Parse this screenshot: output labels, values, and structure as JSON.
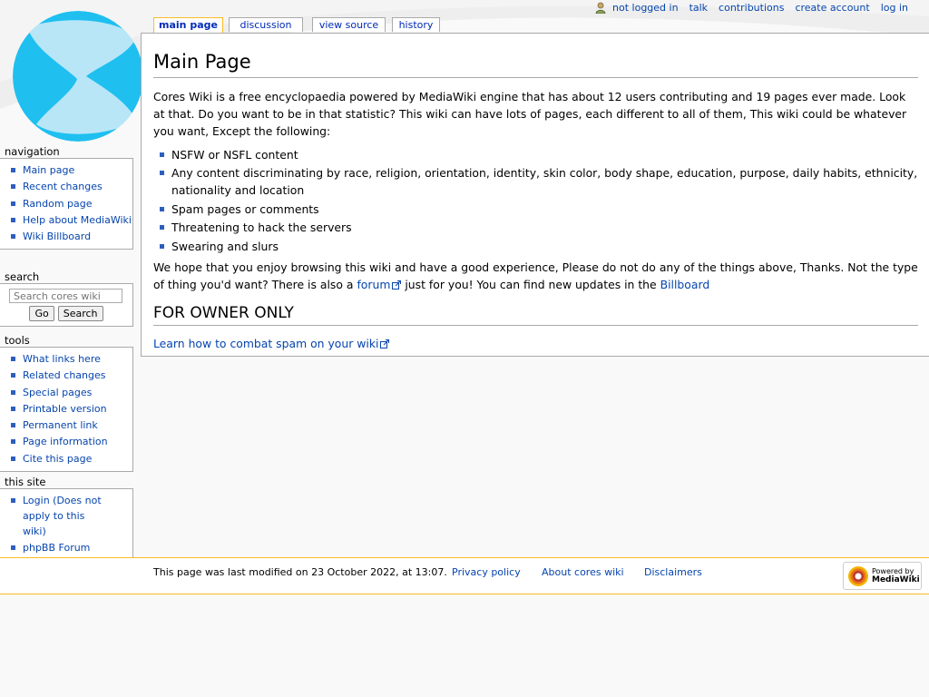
{
  "personal_tools": [
    {
      "label": "not logged in"
    },
    {
      "label": "talk"
    },
    {
      "label": "contributions"
    },
    {
      "label": "create account"
    },
    {
      "label": "log in"
    }
  ],
  "tabs": [
    {
      "label": "main page",
      "selected": true
    },
    {
      "label": "discussion"
    },
    {
      "label": "view source"
    },
    {
      "label": "history"
    }
  ],
  "page": {
    "title": "Main Page",
    "intro": "Cores Wiki is a free encyclopaedia powered by MediaWiki engine that has about 12 users contributing and 19 pages ever made. Look at that. Do you want to be in that statistic? This wiki can have lots of pages, each different to all of them, This wiki could be whatever you want, Except the following:",
    "rules": [
      "NSFW or NSFL content",
      "Any content discriminating by race, religion, orientation, identity, skin color, body shape, education, purpose, daily habits, ethnicity, nationality and location",
      "Spam pages or comments",
      "Threatening to hack the servers",
      "Swearing and slurs"
    ],
    "outro_before_forum": "We hope that you enjoy browsing this wiki and have a good experience, Please do not do any of the things above, Thanks. Not the type of thing you'd want? There is also a ",
    "forum_link": "forum",
    "outro_middle": " just for you! You can find new updates in the ",
    "billboard_link": "Billboard",
    "owner_heading": "FOR OWNER ONLY",
    "spam_link": "Learn how to combat spam on your wiki"
  },
  "navigation": {
    "title": "navigation",
    "items": [
      {
        "label": "Main page"
      },
      {
        "label": "Recent changes"
      },
      {
        "label": "Random page"
      },
      {
        "label": "Help about MediaWiki"
      },
      {
        "label": "Wiki Billboard"
      }
    ]
  },
  "search": {
    "title": "search",
    "placeholder": "Search cores wiki",
    "go_label": "Go",
    "search_label": "Search"
  },
  "tools": {
    "title": "tools",
    "items": [
      {
        "label": "What links here"
      },
      {
        "label": "Related changes"
      },
      {
        "label": "Special pages"
      },
      {
        "label": "Printable version"
      },
      {
        "label": "Permanent link"
      },
      {
        "label": "Page information"
      },
      {
        "label": "Cite this page"
      }
    ]
  },
  "this_site": {
    "title": "this site",
    "items": [
      {
        "label": "Login (Does not apply to this wiki)"
      },
      {
        "label": "phpBB Forum"
      }
    ]
  },
  "footer": {
    "last_modified": "This page was last modified on 23 October 2022, at 13:07.",
    "links": [
      {
        "label": "Privacy policy"
      },
      {
        "label": "About cores wiki"
      },
      {
        "label": "Disclaimers"
      }
    ],
    "powered_by_line1": "Powered by",
    "powered_by_line2": "MediaWiki"
  },
  "colors": {
    "link": "#0645ad",
    "accent_border": "#fabd23",
    "bullet": "#2c5ebf",
    "logo_blue": "#1fbff0",
    "logo_light": "#b8e6f7"
  },
  "icons": {
    "user": "user-icon",
    "external_link": "external-link-icon",
    "logo": "wiki-logo",
    "mediawiki": "mediawiki-sunflower-icon"
  }
}
